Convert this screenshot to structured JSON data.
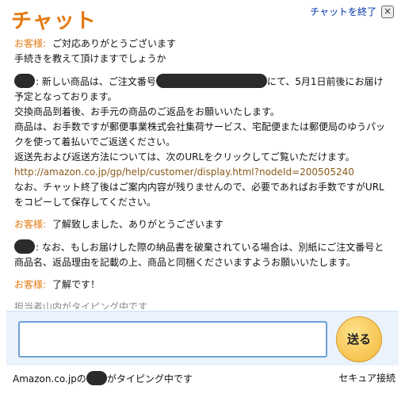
{
  "header": {
    "title": "チャット",
    "end_chat_label": "チャットを終了",
    "close_glyph": "×"
  },
  "messages": [
    {
      "speaker": "お客様:",
      "text": "ご対応ありがとうございます\n手続きを教えて頂けますでしょうか"
    },
    {
      "speaker": "",
      "text_before": ": 新しい商品は、ご注文番号",
      "text_after": "にて、5月1日前後にお届け予定となっております。\n交換商品到着後、お手元の商品のご返品をお願いいたします。\n商品は、お手数ですが郵便事業株式会社集荷サービス、宅配便または郵便局のゆうパックを使って着払いでご返送ください。\n返送先および返送方法については、次のURLをクリックしてご覧いただけます。",
      "link": "http://amazon.co.jp/gp/help/customer/display.html?nodeId=200505240",
      "text_end": "なお、チャット終了後はご案内内容が残りませんので、必要であればお手数ですがURLをコピーして保存してください。"
    },
    {
      "speaker": "お客様:",
      "text": "了解致しました、ありがとうございます"
    },
    {
      "speaker": "",
      "text": ": なお、もしお届けした際の納品書を破棄されている場合は、別紙にご注文番号と商品名、返品理由を記載の上、商品と同梱くださいますようお願いいたします。"
    },
    {
      "speaker": "お客様:",
      "text": "了解です！"
    }
  ],
  "typing_indicator": "担当者山内がタイピング中です",
  "input": {
    "value": "",
    "placeholder": ""
  },
  "send_label": "送る",
  "footer": {
    "left_prefix": "Amazon.co.jpの",
    "left_suffix": "がタイピング中です",
    "right": "セキュア接続"
  },
  "colors": {
    "accent": "#e47911",
    "link": "#8a5a1a",
    "panel": "#eaf3fb"
  }
}
